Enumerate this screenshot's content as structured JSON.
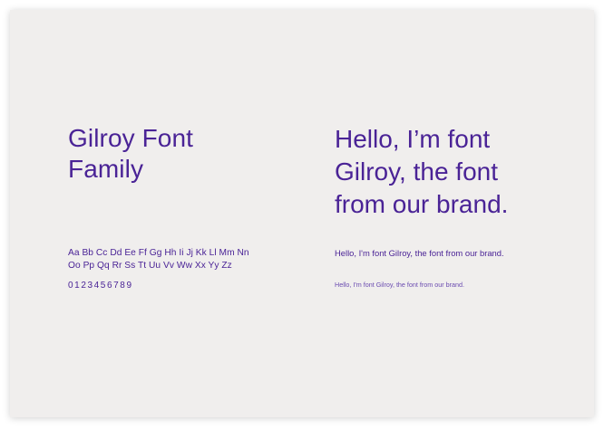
{
  "left": {
    "title": "Gilroy Font\nFamily",
    "alphabet": "Aa Bb Cc Dd Ee Ff Gg Hh Ii Jj Kk Ll Mm Nn\nOo Pp Qq Rr Ss Tt Uu Vv Ww Xx Yy Zz",
    "digits": "0123456789"
  },
  "right": {
    "headline": "Hello, I’m font\nGilroy, the font\nfrom our brand.",
    "sample_medium": "Hello, I'm font Gilroy, the font from our brand.",
    "sample_small": "Hello, I'm font Gilroy, the font from our brand."
  },
  "colors": {
    "text": "#4a2396",
    "card_background": "#f0eeed"
  }
}
